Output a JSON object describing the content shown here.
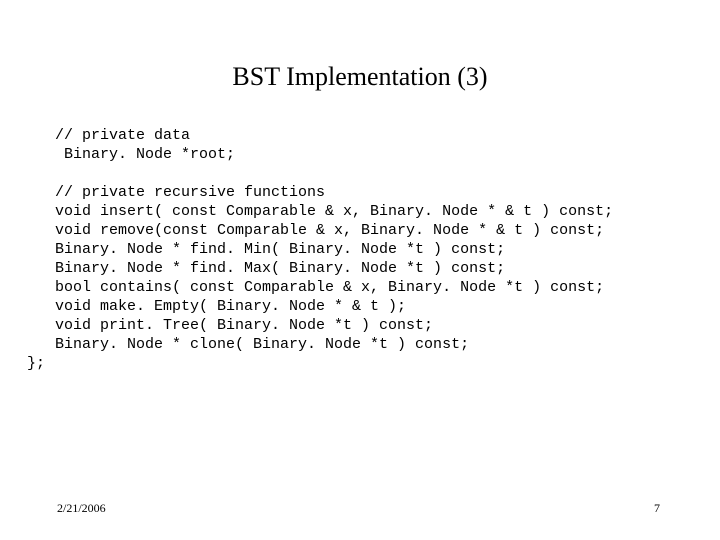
{
  "title": "BST Implementation (3)",
  "code": {
    "c0": "// private data",
    "c1": " Binary. Node *root;",
    "c2": "",
    "c3": "// private recursive functions",
    "c4": "void insert( const Comparable & x, Binary. Node * & t ) const;",
    "c5": "void remove(const Comparable & x, Binary. Node * & t ) const;",
    "c6": "Binary. Node * find. Min( Binary. Node *t ) const;",
    "c7": "Binary. Node * find. Max( Binary. Node *t ) const;",
    "c8": "bool contains( const Comparable & x, Binary. Node *t ) const;",
    "c9": "void make. Empty( Binary. Node * & t );",
    "c10": "void print. Tree( Binary. Node *t ) const;",
    "c11": "Binary. Node * clone( Binary. Node *t ) const;",
    "end": "};"
  },
  "footer": {
    "date": "2/21/2006",
    "page": "7"
  }
}
